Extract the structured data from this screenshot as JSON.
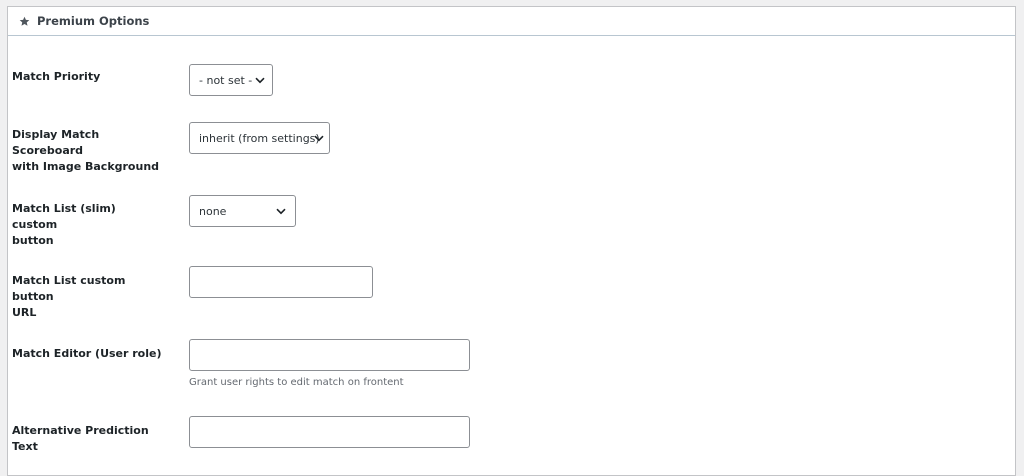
{
  "panel": {
    "title": "Premium Options"
  },
  "fields": {
    "match_priority": {
      "label": "Match Priority",
      "value": "- not set -"
    },
    "scoreboard_background": {
      "label_line1": "Display Match Scoreboard",
      "label_line2": "with Image Background",
      "value": "inherit (from settings)"
    },
    "slim_custom_button": {
      "label_line1": "Match List (slim) custom",
      "label_line2": "button",
      "value": "none"
    },
    "custom_button_url": {
      "label_line1": "Match List custom button",
      "label_line2": "URL",
      "value": ""
    },
    "match_editor": {
      "label": "Match Editor (User role)",
      "value": "",
      "help": "Grant user rights to edit match on frontent"
    },
    "alt_prediction_text": {
      "label": "Alternative Prediction Text",
      "value": ""
    }
  },
  "icons": {
    "panel_icon": "star-icon",
    "select_icon": "chevron-down-icon"
  }
}
